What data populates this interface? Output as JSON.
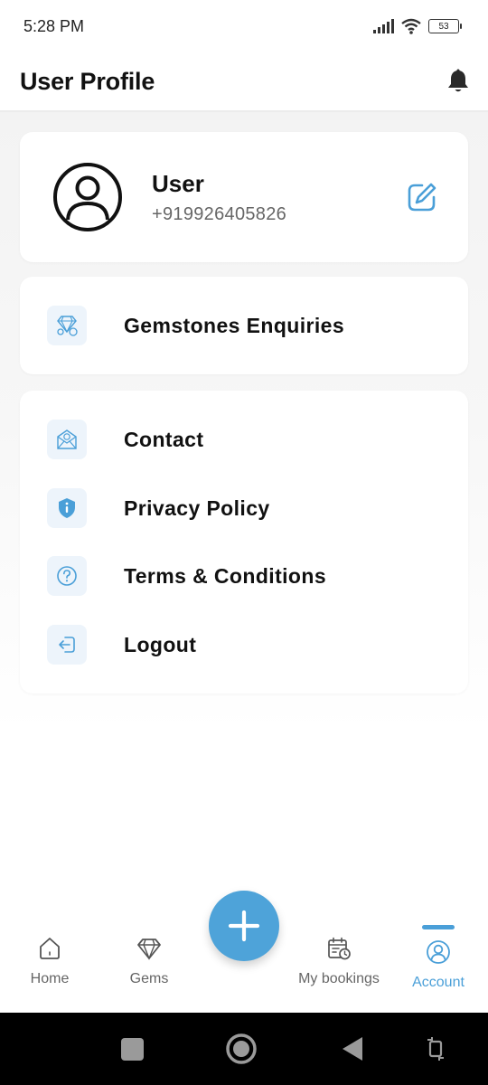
{
  "status_bar": {
    "time": "5:28 PM",
    "battery": "53"
  },
  "header": {
    "title": "User Profile",
    "bell_icon": "bell-icon"
  },
  "profile": {
    "name": "User",
    "phone": "+919926405826",
    "avatar_icon": "user-avatar-icon",
    "edit_icon": "edit-icon"
  },
  "enquiries": {
    "label": "Gemstones Enquiries",
    "icon": "gem-enquiry-icon"
  },
  "menu": [
    {
      "label": "Contact",
      "icon": "contact-mail-icon"
    },
    {
      "label": "Privacy Policy",
      "icon": "shield-info-icon"
    },
    {
      "label": "Terms & Conditions",
      "icon": "question-circle-icon"
    },
    {
      "label": "Logout",
      "icon": "logout-icon"
    }
  ],
  "bottom_nav": {
    "items": [
      {
        "label": "Home",
        "icon": "home-icon"
      },
      {
        "label": "Gems",
        "icon": "diamond-icon"
      },
      {
        "label": "My bookings",
        "icon": "calendar-clock-icon"
      },
      {
        "label": "Account",
        "icon": "account-icon",
        "active": true
      }
    ],
    "fab_icon": "plus-icon"
  },
  "colors": {
    "accent": "#4a9fd8",
    "icon_bg": "#edf4fb",
    "fab": "#4ea3d9"
  }
}
